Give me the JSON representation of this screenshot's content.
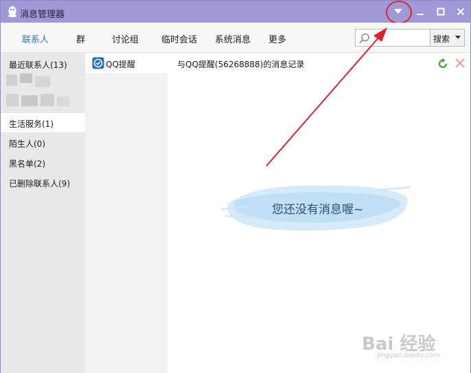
{
  "window": {
    "title": "消息管理器"
  },
  "tabs": [
    {
      "label": "联系人",
      "active": true
    },
    {
      "label": "群"
    },
    {
      "label": "讨论组"
    },
    {
      "label": "临时会话"
    },
    {
      "label": "系统消息"
    },
    {
      "label": "更多"
    }
  ],
  "search": {
    "placeholder": "",
    "button_label": "搜索"
  },
  "categories": [
    {
      "label": "最近联系人(13)"
    },
    {
      "label": "生活服务(1)",
      "selected": true
    },
    {
      "label": "陌生人(0)"
    },
    {
      "label": "黑名单(2)"
    },
    {
      "label": "已删除联系人(9)"
    }
  ],
  "contacts": [
    {
      "name": "QQ提醒"
    }
  ],
  "messages": {
    "record_title": "与QQ提醒(56268888)的消息记录",
    "empty_text": "您还没有消息喔~"
  },
  "watermark": {
    "text": "Bai 经验",
    "sub": "jingyan.baidu.com"
  },
  "colors": {
    "titlebar": "#9f99d8",
    "active_tab": "#2a78c8",
    "annotation": "#e0252d",
    "left_panel": "#e8e8e8"
  },
  "icons": {
    "title": "qq-penguin-icon",
    "dropdown": "triangle-down-icon",
    "minimize": "minimize-icon",
    "maximize": "maximize-icon",
    "close": "close-icon",
    "search": "search-icon",
    "contact": "qq-reminder-icon",
    "refresh": "refresh-icon",
    "delete": "delete-icon"
  }
}
